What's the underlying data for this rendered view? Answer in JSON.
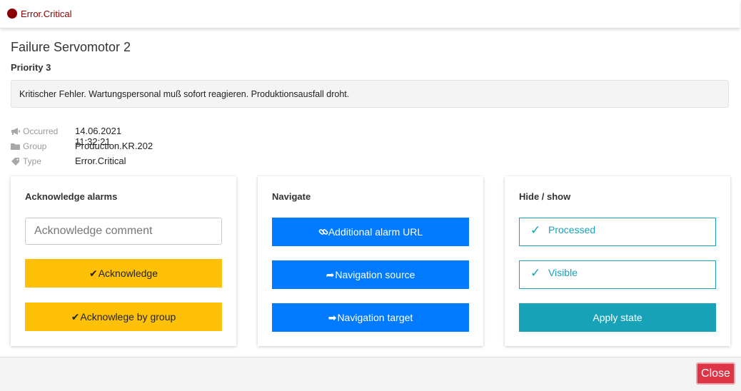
{
  "header": {
    "severity_label": "Error.Critical",
    "severity_color": "#8b0000",
    "severity_icon": "severity-dot"
  },
  "alarm": {
    "title": "Failure Servomotor 2",
    "priority": "Priority 3",
    "message": "Kritischer Fehler. Wartungspersonal muß sofort reagieren. Produktionsausfall droht."
  },
  "details": [
    {
      "icon": "bullhorn-icon",
      "label": "Occurred",
      "value": "14.06.2021 11:32:21"
    },
    {
      "icon": "folder-icon",
      "label": "Group",
      "value": "Production.KR.202"
    },
    {
      "icon": "tag-icon",
      "label": "Type",
      "value": "Error.Critical"
    }
  ],
  "acknowledge": {
    "title": "Acknowledge alarms",
    "comment_placeholder": "Acknowledge comment",
    "comment_value": "",
    "acknowledge_label": "Acknowledge",
    "acknowledge_group_label": "Acknowlege by group",
    "button_color": "#ffc107"
  },
  "navigate": {
    "title": "Navigate",
    "alarm_url_label": "Additional alarm URL",
    "source_label": "Navigation source",
    "target_label": "Navigation target",
    "button_color": "#007bff"
  },
  "hide_show": {
    "title": "Hide / show",
    "processed_label": "Processed",
    "processed_checked": true,
    "visible_label": "Visible",
    "visible_checked": true,
    "apply_label": "Apply state",
    "button_color": "#17a2b8"
  },
  "footer": {
    "close_label": "Close",
    "close_color": "#dc3545"
  }
}
